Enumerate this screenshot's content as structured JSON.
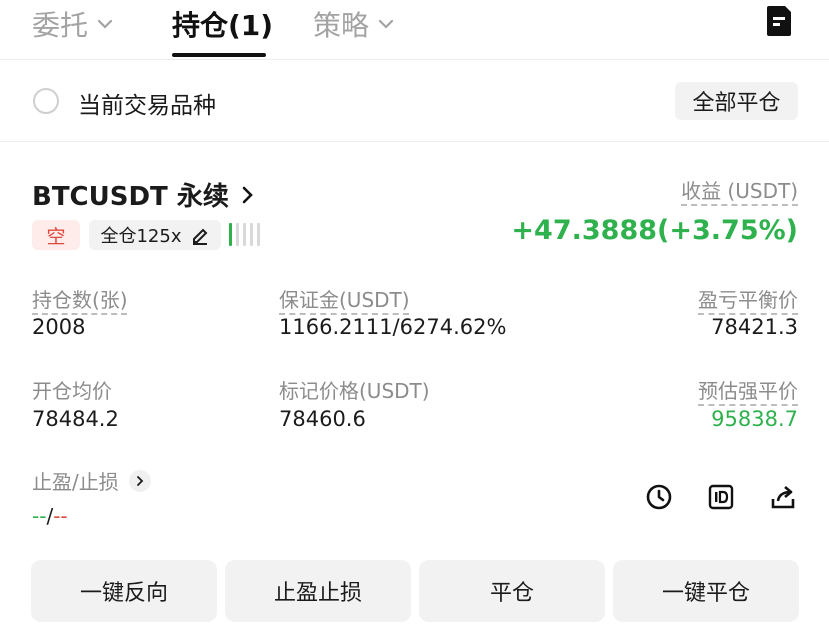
{
  "tabs": [
    {
      "label": "委托"
    },
    {
      "label": "持仓(1)"
    },
    {
      "label": "策略"
    }
  ],
  "filter": {
    "label": "当前交易品种",
    "close_all": "全部平仓"
  },
  "position": {
    "symbol": "BTCUSDT 永续",
    "side": "空",
    "leverage": "全仓125x",
    "pnl_label": "收益 (USDT)",
    "pnl_value": "+47.3888(+3.75%)",
    "fields": {
      "qty_label": "持仓数(张)",
      "qty_value": "2008",
      "margin_label": "保证金(USDT)",
      "margin_value": "1166.2111/6274.62%",
      "breakeven_label": "盈亏平衡价",
      "breakeven_value": "78421.3",
      "entry_label": "开仓均价",
      "entry_value": "78484.2",
      "mark_label": "标记价格(USDT)",
      "mark_value": "78460.6",
      "liq_label": "预估强平价",
      "liq_value": "95838.7"
    },
    "tpsl": {
      "label": "止盈/止损",
      "tp": "--",
      "sep": "/",
      "sl": "--"
    }
  },
  "actions": {
    "reverse": "一键反向",
    "tpsl": "止盈止损",
    "close": "平仓",
    "quick_close": "一键平仓"
  },
  "colors": {
    "profit": "#2fb14d",
    "loss": "#e0493f"
  },
  "icons": [
    "chevron-down-icon",
    "document-icon",
    "chevron-right-icon",
    "edit-icon",
    "history-icon",
    "id-icon",
    "share-icon"
  ]
}
